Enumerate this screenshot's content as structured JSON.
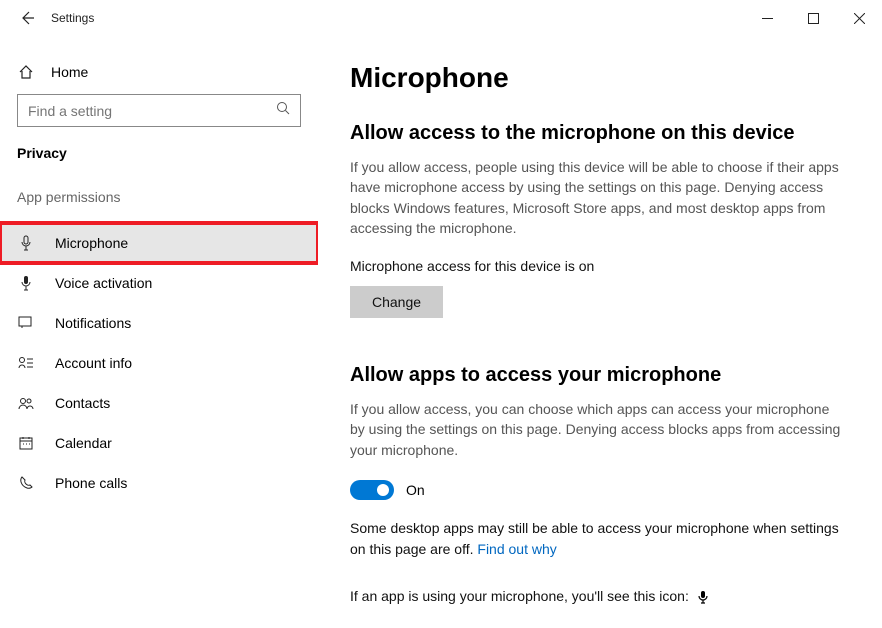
{
  "window": {
    "title": "Settings"
  },
  "sidebar": {
    "home": "Home",
    "search_placeholder": "Find a setting",
    "category": "Privacy",
    "section": "App permissions",
    "items": [
      {
        "label": "Microphone"
      },
      {
        "label": "Voice activation"
      },
      {
        "label": "Notifications"
      },
      {
        "label": "Account info"
      },
      {
        "label": "Contacts"
      },
      {
        "label": "Calendar"
      },
      {
        "label": "Phone calls"
      }
    ]
  },
  "main": {
    "title": "Microphone",
    "section1_heading": "Allow access to the microphone on this device",
    "section1_body": "If you allow access, people using this device will be able to choose if their apps have microphone access by using the settings on this page. Denying access blocks Windows features, Microsoft Store apps, and most desktop apps from accessing the microphone.",
    "device_status": "Microphone access for this device is on",
    "change_button": "Change",
    "section2_heading": "Allow apps to access your microphone",
    "section2_body": "If you allow access, you can choose which apps can access your microphone by using the settings on this page. Denying access blocks apps from accessing your microphone.",
    "toggle_label": "On",
    "desktop_apps_note": "Some desktop apps may still be able to access your microphone when settings on this page are off. ",
    "find_out_why": "Find out why",
    "icon_note": "If an app is using your microphone, you'll see this icon: "
  }
}
